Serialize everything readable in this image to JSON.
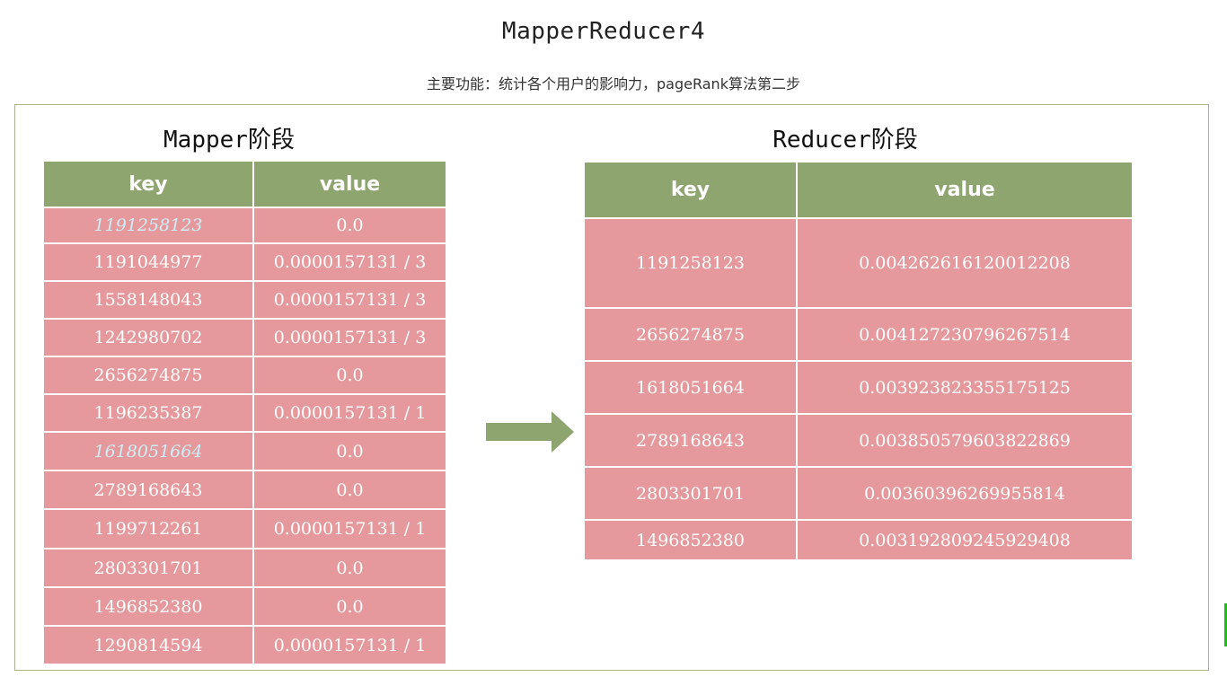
{
  "header": {
    "title": "MapperReducer4",
    "subtitle": "主要功能：统计各个用户的影响力，pageRank算法第二步"
  },
  "mapper": {
    "heading": "Mapper阶段",
    "col_key": "key",
    "col_value": "value",
    "rows": [
      {
        "key": "1191258123",
        "value": "0.0",
        "highlight": true
      },
      {
        "key": "1191044977",
        "value": "0.0000157131 / 3",
        "highlight": false
      },
      {
        "key": "1558148043",
        "value": "0.0000157131 / 3",
        "highlight": false
      },
      {
        "key": "1242980702",
        "value": "0.0000157131 / 3",
        "highlight": false
      },
      {
        "key": "2656274875",
        "value": "0.0",
        "highlight": false
      },
      {
        "key": "1196235387",
        "value": "0.0000157131 / 1",
        "highlight": false
      },
      {
        "key": "1618051664",
        "value": "0.0",
        "highlight": true
      },
      {
        "key": "2789168643",
        "value": "0.0",
        "highlight": false
      },
      {
        "key": "1199712261",
        "value": "0.0000157131 / 1",
        "highlight": false
      },
      {
        "key": "2803301701",
        "value": "0.0",
        "highlight": false
      },
      {
        "key": "1496852380",
        "value": "0.0",
        "highlight": false
      },
      {
        "key": "1290814594",
        "value": "0.0000157131 / 1",
        "highlight": false
      }
    ]
  },
  "reducer": {
    "heading": "Reducer阶段",
    "col_key": "key",
    "col_value": "value",
    "rows": [
      {
        "key": "1191258123",
        "value": "0.004262616120012208"
      },
      {
        "key": "2656274875",
        "value": "0.004127230796267514"
      },
      {
        "key": "1618051664",
        "value": "0.003923823355175125"
      },
      {
        "key": "2789168643",
        "value": "0.003850579603822869"
      },
      {
        "key": "2803301701",
        "value": "0.00360396269955814"
      },
      {
        "key": "1496852380",
        "value": "0.003192809245929408"
      }
    ]
  },
  "colors": {
    "header_green": "#8ea570",
    "cell_pink": "#e6999d",
    "highlight_text": "#cdeff3",
    "arrow": "#8ea570"
  },
  "icons": {
    "flow": "arrow-right-icon"
  }
}
